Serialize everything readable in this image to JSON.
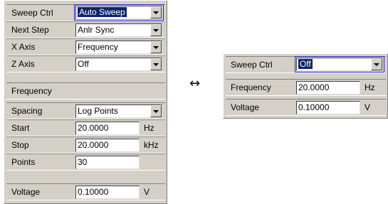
{
  "left_panel": {
    "sweep_ctrl": {
      "label": "Sweep Ctrl",
      "value": "Auto Sweep"
    },
    "next_step": {
      "label": "Next Step",
      "value": "Anlr Sync"
    },
    "x_axis": {
      "label": "X Axis",
      "value": "Frequency"
    },
    "z_axis": {
      "label": "Z Axis",
      "value": "Off"
    },
    "frequency_header": "Frequency",
    "spacing": {
      "label": "Spacing",
      "value": "Log Points"
    },
    "start": {
      "label": "Start",
      "value": "20.0000",
      "unit": "Hz"
    },
    "stop": {
      "label": "Stop",
      "value": "20.0000",
      "unit": "kHz"
    },
    "points": {
      "label": "Points",
      "value": "30"
    },
    "voltage": {
      "label": "Voltage",
      "value": "0.10000",
      "unit": "V"
    }
  },
  "arrow": "↔",
  "right_panel": {
    "sweep_ctrl": {
      "label": "Sweep Ctrl",
      "value": "Off"
    },
    "frequency": {
      "label": "Frequency",
      "value": "20.0000",
      "unit": "Hz"
    },
    "voltage": {
      "label": "Voltage",
      "value": "0.10000",
      "unit": "V"
    }
  }
}
